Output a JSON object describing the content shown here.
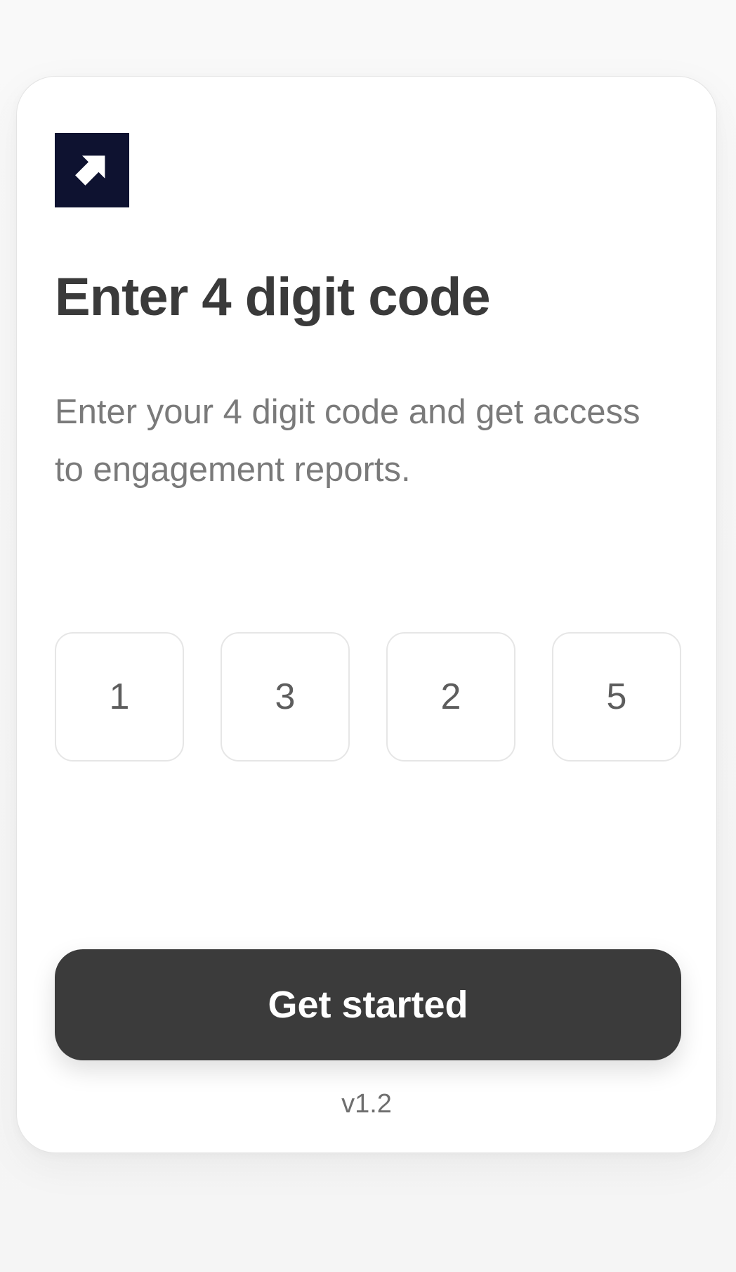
{
  "brand": {
    "logo_icon": "arrow-up-right-icon",
    "logo_color": "#0e1230"
  },
  "heading": {
    "title": "Enter 4 digit code",
    "subtitle": "Enter your 4 digit code and get access to engagement reports."
  },
  "code": {
    "digits": [
      "1",
      "3",
      "2",
      "5"
    ]
  },
  "actions": {
    "submit_label": "Get started",
    "submit_color": "#3b3b3b"
  },
  "footer": {
    "version": "v1.2"
  }
}
